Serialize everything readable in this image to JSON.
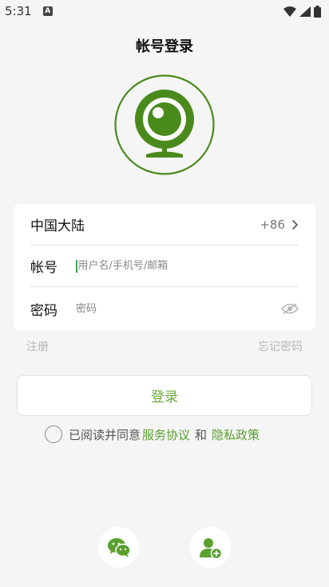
{
  "status_bar": {
    "time": "5:31",
    "badge": "A"
  },
  "header": {
    "title": "帐号登录"
  },
  "form": {
    "region_label": "中国大陆",
    "country_code": "+86",
    "account_label": "帐号",
    "account_placeholder": "用户名/手机号/邮箱",
    "password_label": "密码",
    "password_placeholder": "密码"
  },
  "links": {
    "register": "注册",
    "forgot": "忘记密码"
  },
  "login_button": "登录",
  "agreement": {
    "prefix": "已阅读并同意",
    "service": "服务协议",
    "and": "和",
    "privacy": "隐私政策"
  },
  "colors": {
    "accent": "#6aaa3a",
    "logo": "#4a8a1c",
    "wechat": "#5aa02f"
  },
  "icons": [
    "webcam-logo-icon",
    "chevron-right-icon",
    "eye-off-icon",
    "wechat-icon",
    "add-user-icon"
  ]
}
